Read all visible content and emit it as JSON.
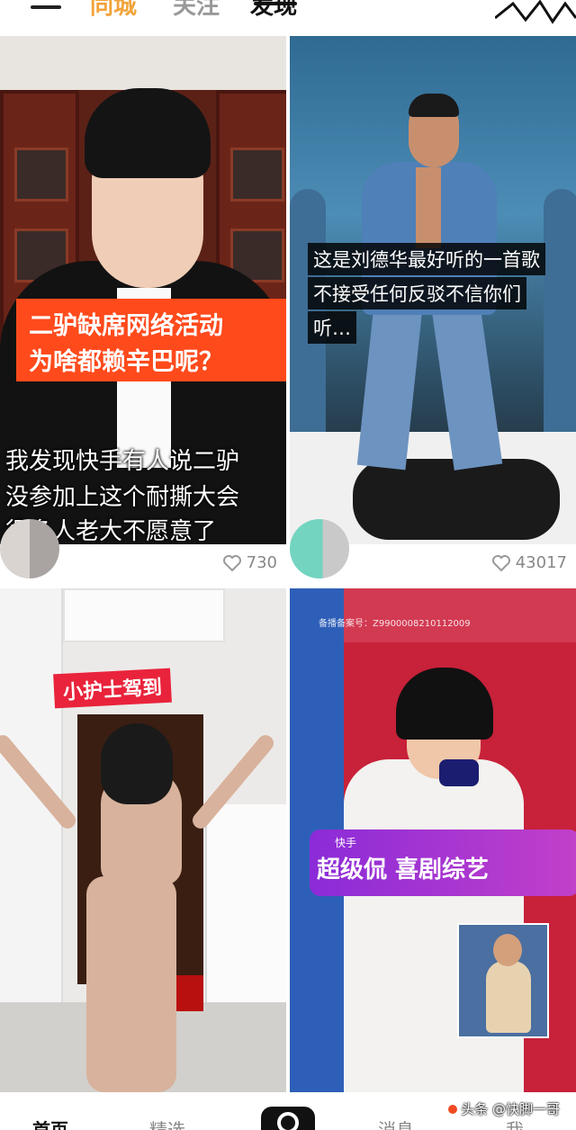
{
  "top_tabs": {
    "same_city": "同城",
    "follow": "关注",
    "discover": "发现"
  },
  "feed": [
    {
      "overlay_title": [
        "二驴缺席网络活动",
        "为啥都赖辛巴呢？"
      ],
      "subtitle": [
        "我发现快手有人说二驴",
        "没参加上这个耐撕大会",
        "很多人老大不愿意了"
      ],
      "likes": "730"
    },
    {
      "caption": [
        "这是刘德华最好听的一首歌",
        "不接受任何反驳不信你们",
        "听…"
      ],
      "likes": "43017"
    },
    {
      "tag": "小护士驾到"
    },
    {
      "record_no": "备播备案号：Z9900008210112009",
      "badge_sub": "快手",
      "badge_title": "超级侃 喜剧综艺"
    }
  ],
  "watermark": "头条 @快脚一哥",
  "bottom_nav": {
    "home": "首页",
    "featured": "精选",
    "message": "消息",
    "me": "我"
  },
  "colors": {
    "accent_orange": "#ff4a1c",
    "same_city_tab": "#f2a33a",
    "tag_red": "#e9233b",
    "badge_purple": "#8b2bd8"
  },
  "icons": [
    "menu-icon",
    "heart-icon",
    "camera-icon"
  ]
}
